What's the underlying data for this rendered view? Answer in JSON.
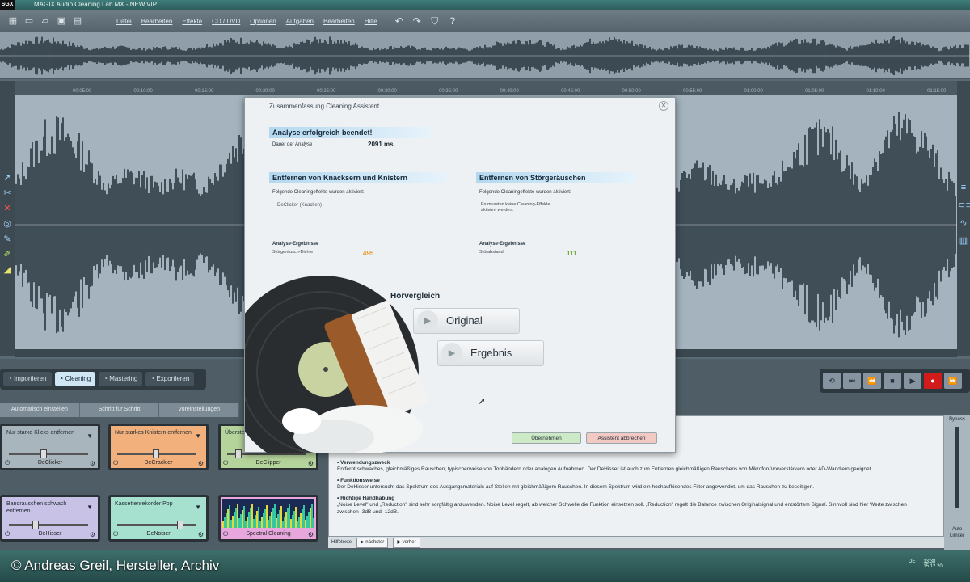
{
  "window": {
    "logo": "SGX",
    "title": "MAGIX Audio Cleaning Lab MX - NEW.VIP"
  },
  "menu": {
    "items": [
      "Datei",
      "Bearbeiten",
      "Effekte",
      "CD / DVD",
      "Optionen",
      "Aufgaben",
      "Bearbeiten",
      "Hilfe"
    ]
  },
  "timeline": {
    "ticks": [
      "00:05:00",
      "00:10:00",
      "00:15:00",
      "00:20:00",
      "00:25:00",
      "00:30:00",
      "00:35:00",
      "00:40:00",
      "00:45:00",
      "00:50:00",
      "00:55:00",
      "01:00:00",
      "01:05:00",
      "01:10:00",
      "01:15:00"
    ]
  },
  "modes": [
    {
      "label": "Importieren",
      "icon": "import-icon"
    },
    {
      "label": "Cleaning",
      "icon": "cleaning-icon"
    },
    {
      "label": "Mastering",
      "icon": "mastering-icon"
    },
    {
      "label": "Exportieren",
      "icon": "export-icon"
    }
  ],
  "steps": [
    "Automatisch einstellen",
    "Schritt für Schritt",
    "Voreinstellungen"
  ],
  "effects": [
    {
      "name": "Nur starke Klicks entfernen",
      "footer": "DeClicker",
      "color": "#a9b5bd",
      "level": 0.4
    },
    {
      "name": "Nur starkes Knistern entfernen",
      "footer": "DeCrackler",
      "color": "#f2b07c",
      "level": 0.45
    },
    {
      "name": "Übersteuerungen entfernen",
      "footer": "DeClipper",
      "color": "#b5d49b",
      "level": 0.1
    },
    {
      "name": "Bandrauschen schwach entfernen",
      "footer": "DeHisser",
      "color": "#c7c2e6",
      "level": 0.3
    },
    {
      "name": "Kassettenrekorder Pop",
      "footer": "DeNoiser",
      "color": "#a6e0cf",
      "level": 0.75
    },
    {
      "name": "",
      "footer": "Spectral Cleaning",
      "color": "#e7a7dc",
      "level": 0
    }
  ],
  "dialog": {
    "title": "Zusammenfassung Cleaning Assistent",
    "analysis_head": "Analyse erfolgreich beendet!",
    "duration_label": "Dauer der Analyse",
    "duration_value": "2091 ms",
    "left_head": "Entfernen von Knacksern und Knistern",
    "left_sub": "Folgende Cleaningeffekte wurden aktiviert:",
    "left_item": "DeClicker (Knacken)",
    "right_head": "Entfernen von Störgeräuschen",
    "right_sub": "Folgende Cleaningeffekte wurden aktiviert:",
    "right_item1": "Es mussten keine Cleaning-Effekte",
    "right_item2": "aktiviert werden.",
    "left_result_head": "Analyse-Ergebnisse",
    "left_result_label": "Störgeräusch-Dichte",
    "left_result_value": "495",
    "right_result_head": "Analyse-Ergebnisse",
    "right_result_label": "Störabstand",
    "right_result_value": "111",
    "compare_head": "Hörvergleich",
    "btn_original": "Original",
    "btn_result": "Ergebnis",
    "btn_apply": "Übernehmen",
    "btn_cancel": "Assistent abbrechen"
  },
  "description": {
    "sec1_title": "• Verwendungszweck",
    "sec1_text": "Entfernt schwaches, gleichmäßiges Rauschen, typischerweise von Tonbändern oder analogen Aufnahmen. Der DeHisser ist auch zum Entfernen gleichmäßigen Rauschens von Mikrofon-Vorverstärkern oder AD-Wandlern geeignet.",
    "sec2_title": "• Funktionsweise",
    "sec2_text": "Der DeHisser untersucht das Spektrum des Ausgangsmaterials auf Stellen mit gleichmäßigem Rauschen. In diesem Spektrum wird ein hochauflösendes Filter angewendet, um das Rauschen zu beseitigen.",
    "sec3_title": "• Richtige Handhabung",
    "sec3_text": "„Noise Level\" und „Reduction\" sind sehr sorgfältig anzuwenden. Noise Level regelt, ab welcher Schwelle die Funktion einsetzen soll. „Reduction\" regelt die Balance zwischen Originalsignal und entstörtem Signal. Sinnvoll sind hier Werte zwischen zwischen -3dB und -12dB.",
    "footer_label": "Hilfetexte",
    "footer_next": "nächster",
    "footer_prev": "vorher"
  },
  "rightpanel": {
    "bypass": "Bypass",
    "auto": "Auto",
    "limiter": "Limiter"
  },
  "taskbar": {
    "copyright": "© Andreas Greil, Hersteller, Archiv",
    "lang": "DE",
    "time": "13:38",
    "date": "15.12.20"
  },
  "colors": {
    "accent": "#b3d8ef",
    "record": "#d21b1b",
    "wave": "#27343e",
    "orange_value": "#e89a2a",
    "green_value": "#6ea63a"
  }
}
